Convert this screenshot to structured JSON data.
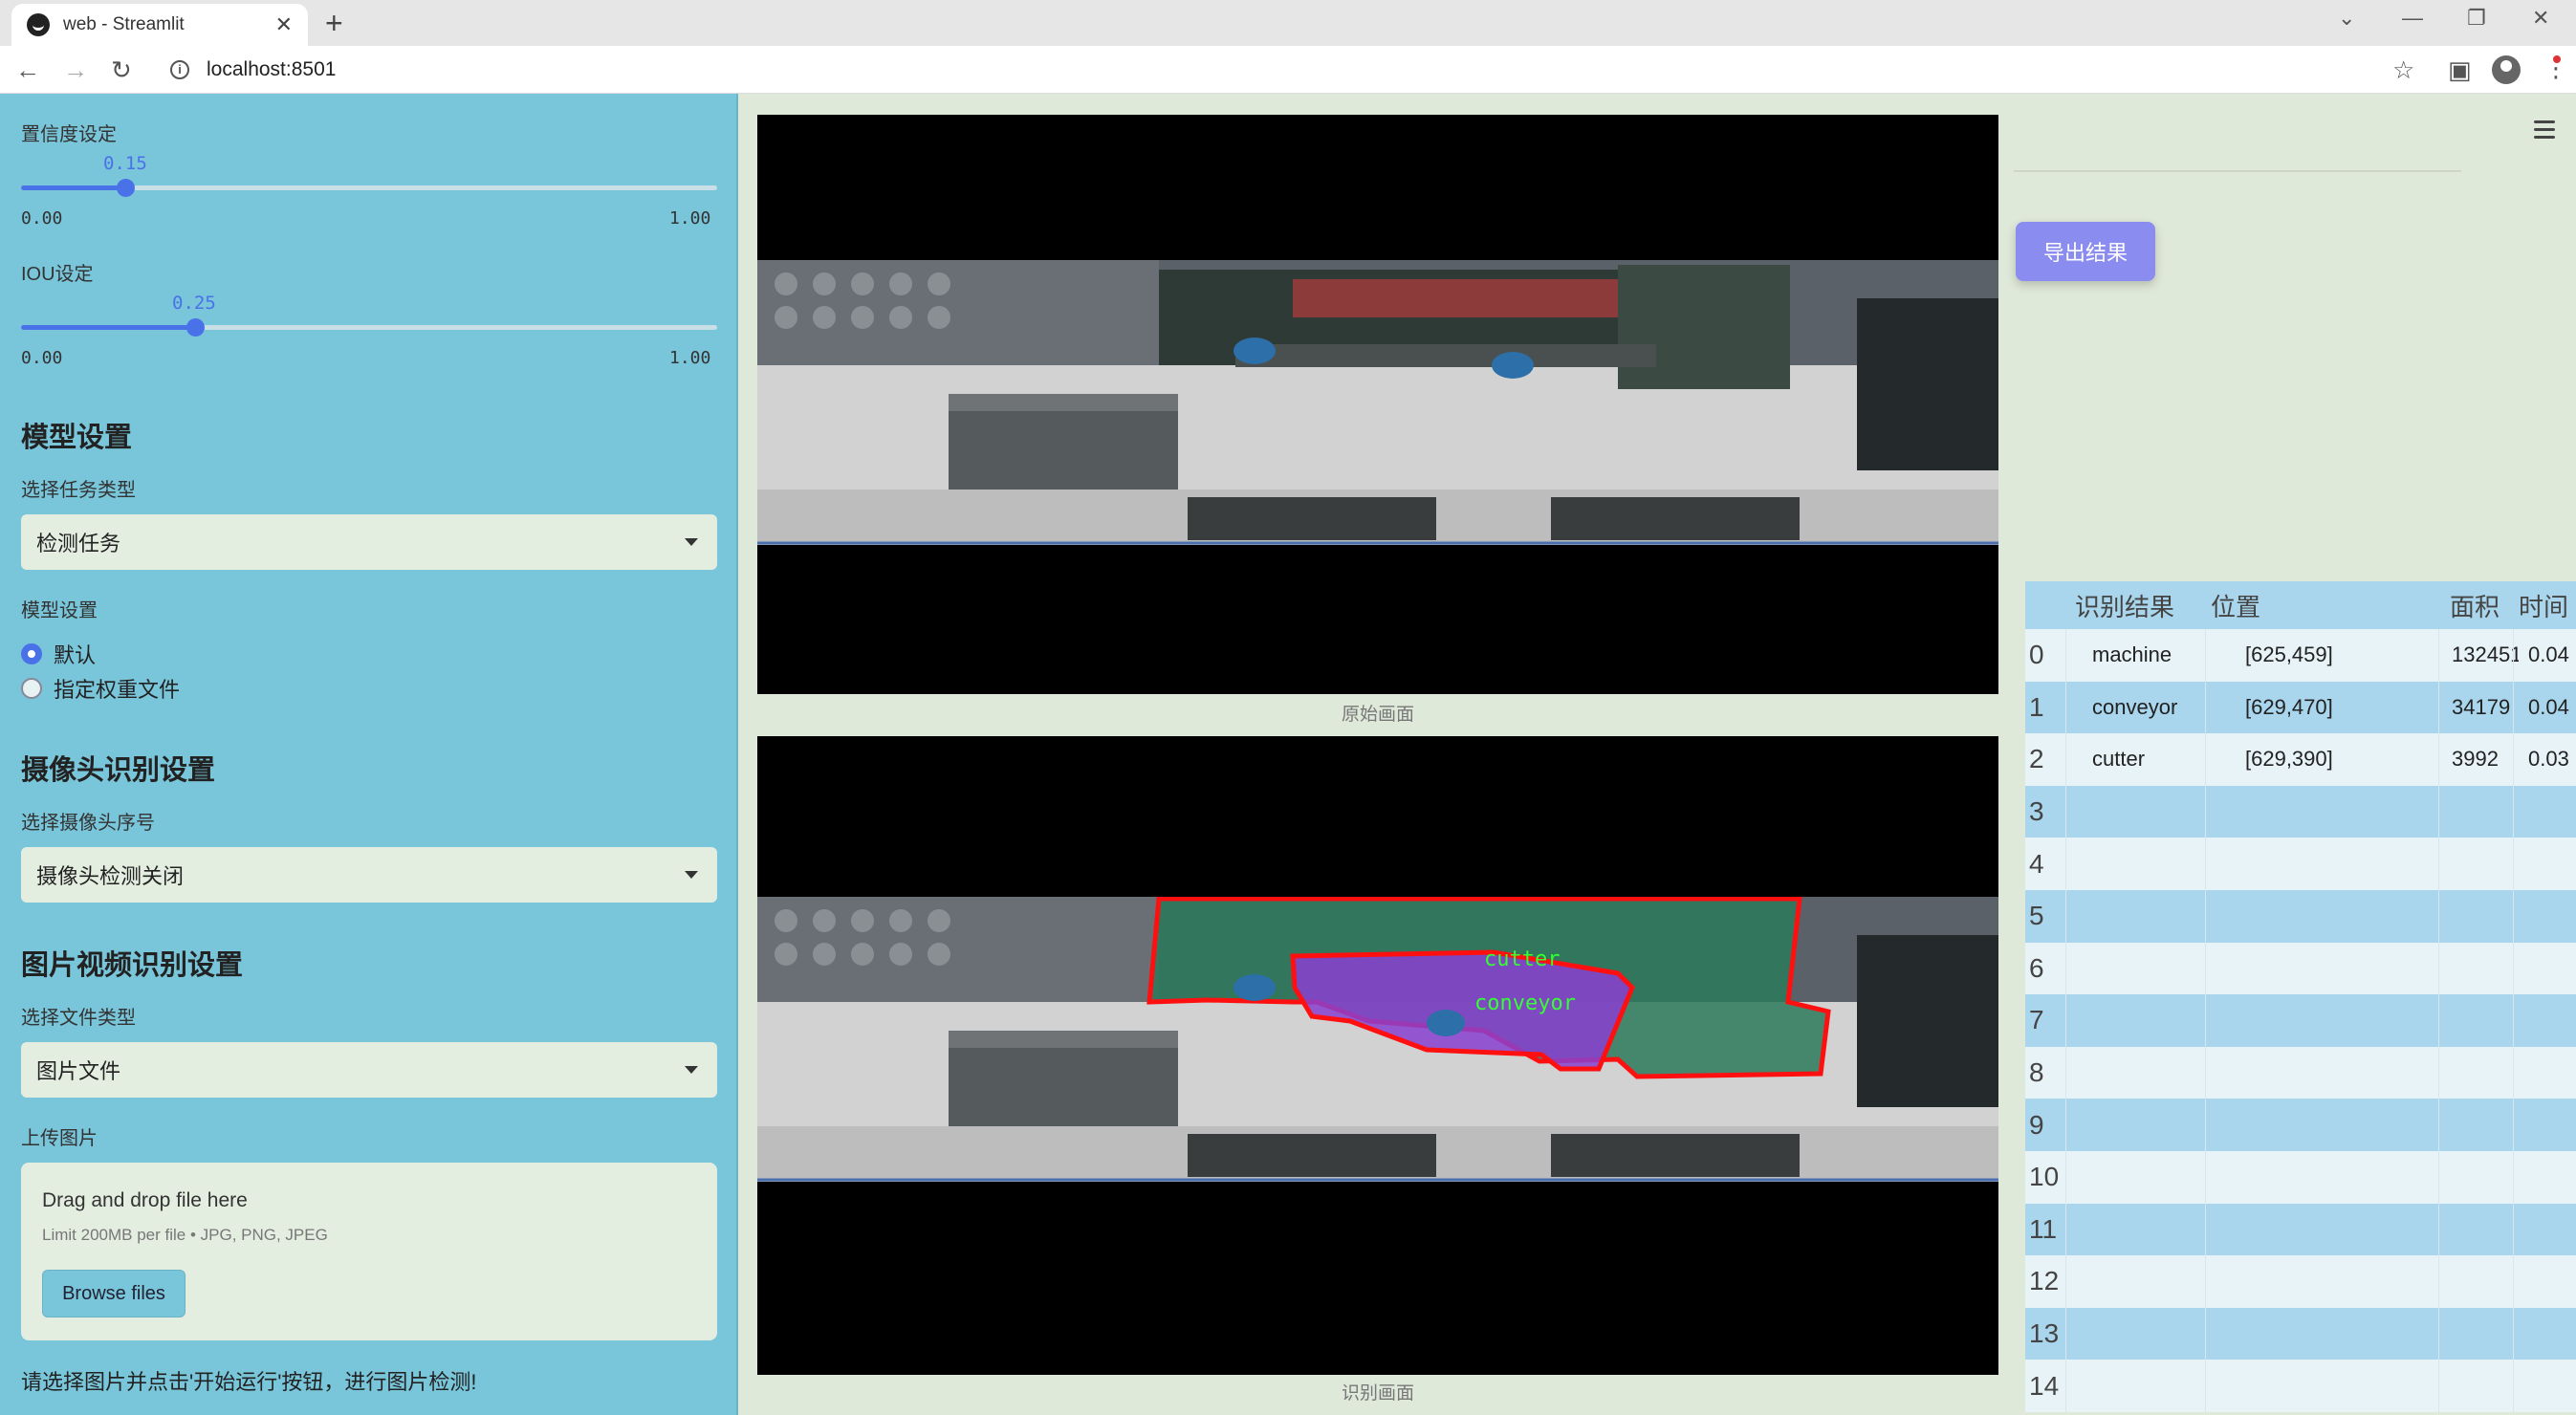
{
  "browser": {
    "tab_title": "web - Streamlit",
    "url": "localhost:8501"
  },
  "sidebar": {
    "confidence": {
      "label": "置信度设定",
      "value": "0.15",
      "min": "0.00",
      "max": "1.00",
      "fraction": 0.15
    },
    "iou": {
      "label": "IOU设定",
      "value": "0.25",
      "min": "0.00",
      "max": "1.00",
      "fraction": 0.25
    },
    "model_section": {
      "title": "模型设置",
      "task_label": "选择任务类型",
      "task_value": "检测任务",
      "model_label": "模型设置",
      "radio_default": "默认",
      "radio_custom": "指定权重文件"
    },
    "camera_section": {
      "title": "摄像头识别设置",
      "camera_label": "选择摄像头序号",
      "camera_value": "摄像头检测关闭"
    },
    "file_section": {
      "title": "图片视频识别设置",
      "type_label": "选择文件类型",
      "type_value": "图片文件",
      "upload_label": "上传图片",
      "drop_text": "Drag and drop file here",
      "limit_text": "Limit 200MB per file • JPG, PNG, JPEG",
      "browse_label": "Browse files"
    },
    "hint": "请选择图片并点击'开始运行'按钮，进行图片检测!"
  },
  "main": {
    "original_caption": "原始画面",
    "result_caption": "识别画面",
    "overlay_labels": [
      "cutter",
      "conveyor"
    ]
  },
  "right": {
    "export_label": "导出结果",
    "table": {
      "headers": [
        "识别结果",
        "位置",
        "面积",
        "时间"
      ],
      "rows": [
        {
          "idx": "0",
          "result": "machine",
          "pos": "[625,459]",
          "area": "132451",
          "time": "0.04"
        },
        {
          "idx": "1",
          "result": "conveyor",
          "pos": "[629,470]",
          "area": "34179",
          "time": "0.04"
        },
        {
          "idx": "2",
          "result": "cutter",
          "pos": "[629,390]",
          "area": "3992",
          "time": "0.03"
        },
        {
          "idx": "3"
        },
        {
          "idx": "4"
        },
        {
          "idx": "5"
        },
        {
          "idx": "6"
        },
        {
          "idx": "7"
        },
        {
          "idx": "8"
        },
        {
          "idx": "9"
        },
        {
          "idx": "10"
        },
        {
          "idx": "11"
        },
        {
          "idx": "12"
        },
        {
          "idx": "13"
        },
        {
          "idx": "14"
        }
      ]
    }
  },
  "colors": {
    "accent": "#4a72e8",
    "sidebar_bg": "#79c5da",
    "export_btn": "#8b8cf0",
    "mask_outline": "#ff0000",
    "label_text": "#33ff33"
  }
}
